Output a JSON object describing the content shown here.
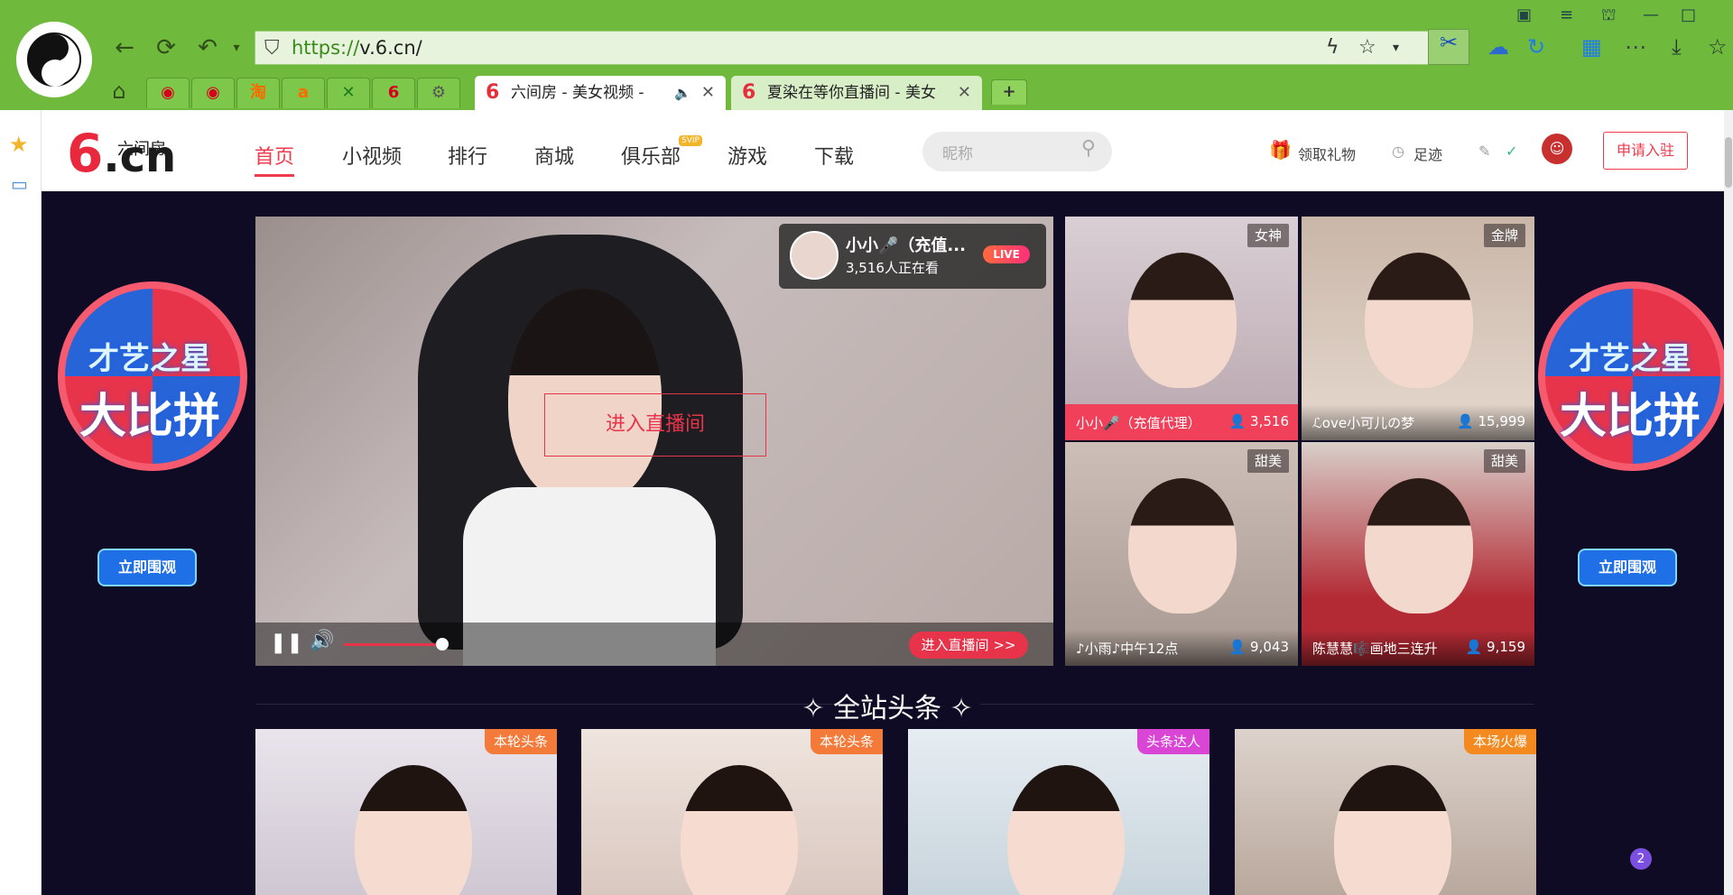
{
  "browser": {
    "url_protocol": "https://",
    "url_rest": "v.6.cn/",
    "tabs": [
      {
        "title": "六间房 - 美女视频 -",
        "active": true
      },
      {
        "title": "夏染在等你直播间 - 美女",
        "active": false
      }
    ],
    "mini_tab_icons": [
      "weibo-icon",
      "weibo-icon",
      "taobao-icon",
      "tmall-icon",
      "xiaomi-icon",
      "six-icon",
      "settings-icon"
    ],
    "mini_tab_glyphs": [
      "◉",
      "◉",
      "淘",
      "a",
      "✕",
      "6",
      "⚙"
    ]
  },
  "site": {
    "logo_main": "6",
    "logo_cn": ".cn",
    "logo_small": "六间房",
    "nav": [
      "首页",
      "小视频",
      "排行",
      "商城",
      "俱乐部",
      "游戏",
      "下载"
    ],
    "nav_badge": "SVIP",
    "search_placeholder": "昵称",
    "gift_link": "领取礼物",
    "footprint_link": "足迹",
    "apply_button": "申请入驻"
  },
  "promo": {
    "line1": "才艺之星",
    "line2": "大比拼",
    "button": "立即围观"
  },
  "player": {
    "host_name": "小小🎤（充值...",
    "viewers": "3,516人正在看",
    "live_badge": "LIVE",
    "enter_center": "进入直播间",
    "enter_button": "进入直播间 >>"
  },
  "thumbs": [
    {
      "tag": "女神",
      "name": "小小🎤（充值代理）",
      "count": "3,516",
      "highlight": true
    },
    {
      "tag": "金牌",
      "name": "ℒove小可儿の梦",
      "count": "15,999",
      "highlight": false
    },
    {
      "tag": "甜美",
      "name": "♪小雨♪中午12点",
      "count": "9,043",
      "highlight": false
    },
    {
      "tag": "甜美",
      "name": "陈慧慧🎼画地三连升",
      "count": "9,159",
      "highlight": false
    }
  ],
  "headlines": {
    "title": "全站头条",
    "cards": [
      {
        "tag": "本轮头条",
        "color": "#f47a3a"
      },
      {
        "tag": "本轮头条",
        "color": "#f47a3a"
      },
      {
        "tag": "头条达人",
        "color": "#d946d6"
      },
      {
        "tag": "本场火爆",
        "color": "#f48a1f"
      }
    ]
  },
  "float_badge": "2",
  "colors": {
    "browser_green": "#6fb93c",
    "accent": "#ef3b4e",
    "page_bg": "#0f0b24"
  }
}
